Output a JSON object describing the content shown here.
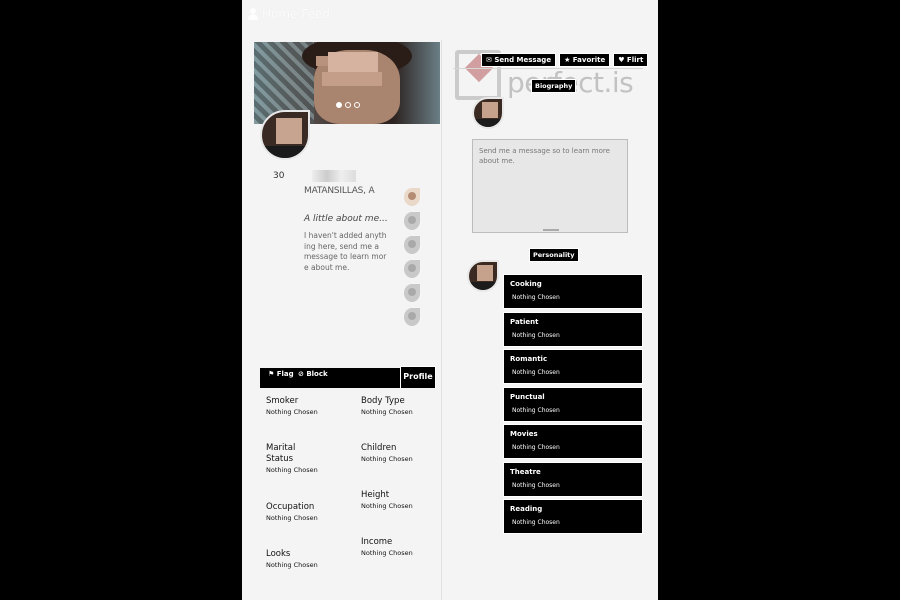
{
  "topbar": {
    "home_label": "Home Feed"
  },
  "profile": {
    "age": "30",
    "location": "MATANSILLAS, A",
    "about_title": "A little about me...",
    "about_text": "I haven't added anything here, send me a message to learn more about me.",
    "carousel_dots": 3
  },
  "actions": {
    "flag_label": "Flag",
    "block_label": "Block",
    "profile_tab": "Profile"
  },
  "attributes": {
    "smoker": {
      "label": "Smoker",
      "value": "Nothing Chosen"
    },
    "body_type": {
      "label": "Body Type",
      "value": "Nothing Chosen"
    },
    "marital_status": {
      "label": "Marital Status",
      "value": "Nothing Chosen"
    },
    "children": {
      "label": "Children",
      "value": "Nothing Chosen"
    },
    "occupation": {
      "label": "Occupation",
      "value": "Nothing Chosen"
    },
    "height": {
      "label": "Height",
      "value": "Nothing Chosen"
    },
    "looks": {
      "label": "Looks",
      "value": "Nothing Chosen"
    },
    "income": {
      "label": "Income",
      "value": "Nothing Chosen"
    }
  },
  "buttons": {
    "send_message": "Send Message",
    "favorite": "Favorite",
    "flirt": "Flirt"
  },
  "watermark": {
    "text": "perfect.is"
  },
  "biography": {
    "tag": "Biography",
    "placeholder": "Send me a message so to learn more about me."
  },
  "personality": {
    "tag": "Personality",
    "traits": [
      {
        "name": "Cooking",
        "value": "Nothing Chosen"
      },
      {
        "name": "Patient",
        "value": "Nothing Chosen"
      },
      {
        "name": "Romantic",
        "value": "Nothing Chosen"
      },
      {
        "name": "Punctual",
        "value": "Nothing Chosen"
      },
      {
        "name": "Movies",
        "value": "Nothing Chosen"
      },
      {
        "name": "Theatre",
        "value": "Nothing Chosen"
      },
      {
        "name": "Reading",
        "value": "Nothing Chosen"
      }
    ]
  },
  "colors": {
    "panel": "#000000",
    "page_bg": "#f4f4f4",
    "outer_bg": "#000000"
  },
  "icons": [
    "user-icon",
    "flag-icon",
    "block-icon",
    "envelope-icon",
    "star-icon",
    "heart-icon"
  ]
}
